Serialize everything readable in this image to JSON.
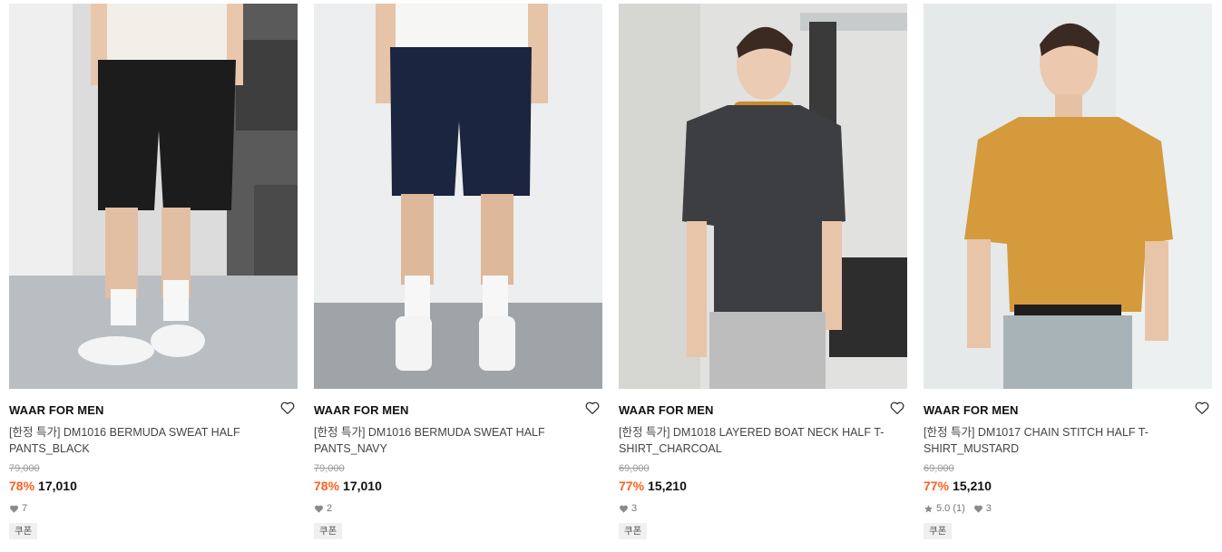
{
  "products": [
    {
      "brand": "WAAR FOR MEN",
      "name": "[한정 특가] DM1016 BERMUDA SWEAT HALF PANTS_BLACK",
      "original_price": "79,000",
      "discount": "78%",
      "price": "17,010",
      "rating": "",
      "likes": "7",
      "coupon": "쿠폰",
      "image": "model-black-shorts"
    },
    {
      "brand": "WAAR FOR MEN",
      "name": "[한정 특가] DM1016 BERMUDA SWEAT HALF PANTS_NAVY",
      "original_price": "79,000",
      "discount": "78%",
      "price": "17,010",
      "rating": "",
      "likes": "2",
      "coupon": "쿠폰",
      "image": "model-navy-shorts"
    },
    {
      "brand": "WAAR FOR MEN",
      "name": "[한정 특가] DM1018 LAYERED BOAT NECK HALF T-SHIRT_CHARCOAL",
      "original_price": "69,000",
      "discount": "77%",
      "price": "15,210",
      "rating": "",
      "likes": "3",
      "coupon": "쿠폰",
      "image": "model-charcoal-tshirt"
    },
    {
      "brand": "WAAR FOR MEN",
      "name": "[한정 특가] DM1017 CHAIN STITCH HALF T-SHIRT_MUSTARD",
      "original_price": "69,000",
      "discount": "77%",
      "price": "15,210",
      "rating": "5.0 (1)",
      "likes": "3",
      "coupon": "쿠폰",
      "image": "model-mustard-tshirt"
    }
  ],
  "colors": {
    "discount": "#ff5f1f",
    "brand_text": "#111111",
    "meta": "#777777"
  },
  "icons": {
    "wishlist": "heart-outline-icon",
    "likes": "heart-filled-icon",
    "rating": "star-icon"
  }
}
